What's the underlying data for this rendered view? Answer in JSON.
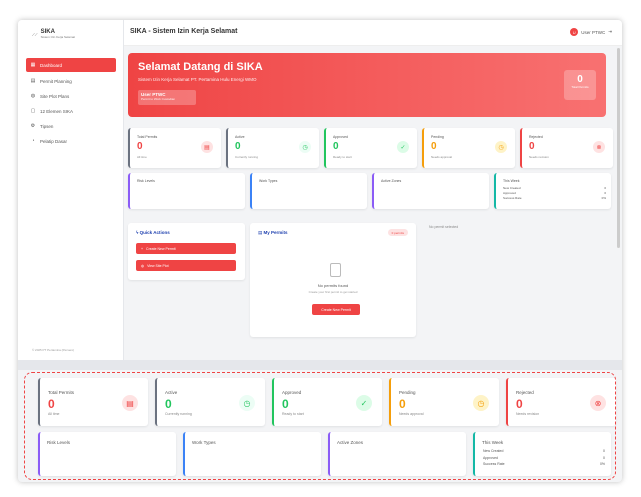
{
  "logo": {
    "title": "SIKA",
    "subtitle": "Sistem Izin Kerja Selamat"
  },
  "sidebar": {
    "items": [
      {
        "label": "Dashboard",
        "icon": "grid-icon",
        "glyph": "▦",
        "active": true
      },
      {
        "label": "Permit Planning",
        "icon": "clipboard-icon",
        "glyph": "▤",
        "active": false
      },
      {
        "label": "Site Plot Plans",
        "icon": "map-icon",
        "glyph": "◍",
        "active": false
      },
      {
        "label": "12 Elemen SIKA",
        "icon": "document-icon",
        "glyph": "▢",
        "active": false
      },
      {
        "label": "Tipsen",
        "icon": "gear-icon",
        "glyph": "⚙",
        "active": false
      },
      {
        "label": "Pelatip Dasar",
        "icon": "user-icon",
        "glyph": "◔",
        "active": false
      }
    ],
    "copyright": "© 2025 PT Pertamina (Persero)"
  },
  "header": {
    "title": "SIKA - Sistem Izin Kerja Selamat",
    "user_initial": "U",
    "user_name": "User PTWC"
  },
  "banner": {
    "title": "Selamat Datang di SIKA",
    "subtitle": "Sistem Izin Kerja Selamat PT. Pertamina Hulu Energi WMO",
    "user_name": "User PTWC",
    "user_role": "Permit to Work Custodian",
    "count": "0",
    "count_label": "Total Permits"
  },
  "stats": [
    {
      "label": "Total Permits",
      "value": "0",
      "sub": "All time",
      "icon": "document-icon",
      "glyph": "▤",
      "color": "#6b7280",
      "bg": "#fee2e2",
      "fg": "#ef4444"
    },
    {
      "label": "Active",
      "value": "0",
      "sub": "Currently running",
      "icon": "clock-icon",
      "glyph": "◷",
      "color": "#6b7280",
      "bg": "#ecfdf5",
      "fg": "#22c55e"
    },
    {
      "label": "Approved",
      "value": "0",
      "sub": "Ready to start",
      "icon": "check-icon",
      "glyph": "✓",
      "color": "#22c55e",
      "bg": "#dcfce7",
      "fg": "#22c55e"
    },
    {
      "label": "Pending",
      "value": "0",
      "sub": "Needs approval",
      "icon": "clock-icon",
      "glyph": "◷",
      "color": "#f59e0b",
      "bg": "#fef3c7",
      "fg": "#f59e0b"
    },
    {
      "label": "Rejected",
      "value": "0",
      "sub": "Needs revision",
      "icon": "x-circle-icon",
      "glyph": "⊗",
      "color": "#ef4444",
      "bg": "#fee2e2",
      "fg": "#ef4444"
    }
  ],
  "infos": [
    {
      "title": "Risk Levels",
      "color": "#8b5cf6"
    },
    {
      "title": "Work Types",
      "color": "#3b82f6"
    },
    {
      "title": "Active Zones",
      "color": "#8b5cf6"
    },
    {
      "title": "This Week",
      "color": "#14b8a6",
      "rows": [
        {
          "label": "New Created",
          "value": "0"
        },
        {
          "label": "Approved",
          "value": "0"
        },
        {
          "label": "Success Rate",
          "value": "0%"
        }
      ]
    }
  ],
  "quick_actions": {
    "title": "Quick Actions",
    "buttons": [
      {
        "label": "Create New Permit",
        "icon": "plus-icon",
        "glyph": "+"
      },
      {
        "label": "View Site Plot",
        "icon": "map-icon",
        "glyph": "◍"
      }
    ]
  },
  "my_permits": {
    "title": "My Permits",
    "badge": "0 permits",
    "empty_title": "No permits found",
    "empty_sub": "Create your first permit to get started",
    "create_button": "Create New Permit"
  },
  "no_permit_selected": "No permit selected"
}
